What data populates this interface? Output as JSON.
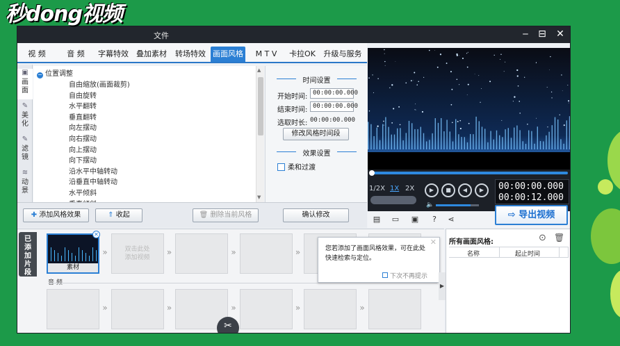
{
  "watermark": "秒dong视频",
  "window": {
    "title_suffix": "文件",
    "minimize": "‒",
    "maximize": "⊟",
    "close": "✕"
  },
  "tabs": [
    "视  频",
    "音  频",
    "字幕特效",
    "叠加素材",
    "转场特效",
    "画面风格",
    "M T V",
    "卡拉OK",
    "升级与服务"
  ],
  "active_tab": "画面风格",
  "side_tabs": [
    {
      "label": "画面",
      "icon": "square-icon"
    },
    {
      "label": "美化",
      "icon": "wand-icon"
    },
    {
      "label": "滤镜",
      "icon": "wand-icon"
    },
    {
      "label": "动景",
      "icon": "wave-icon"
    }
  ],
  "tree": {
    "header": "位置调整",
    "items": [
      "自由缩放(画面裁剪)",
      "自由旋转",
      "水平翻转",
      "垂直翻转",
      "向左摆动",
      "向右摆动",
      "向上摆动",
      "向下摆动",
      "沿水平中轴转动",
      "沿垂直中轴转动",
      "水平倾斜",
      "垂直倾斜"
    ]
  },
  "settings": {
    "time_header": "时间设置",
    "start_label": "开始时间:",
    "start_value": "00:00:00.000",
    "end_label": "结束时间:",
    "end_value": "00:00:00.000",
    "duration_label": "选取时长:",
    "duration_value": "00:00:00.000",
    "modify_range_button": "修改风格时间段",
    "effect_header": "效果设置",
    "fade_checkbox": "柔和过渡"
  },
  "actions": {
    "add_style": "添加风格效果",
    "collapse": "收起",
    "delete_style": "删除当前风格",
    "confirm": "确认修改"
  },
  "player": {
    "speeds": [
      "1/2X",
      "1X",
      "2X"
    ],
    "active_speed": "1X",
    "current_time": "00:00:00.000",
    "total_time": "00:00:12.000",
    "volume": 0.8
  },
  "export_button": "导出视频",
  "timeline": {
    "side_label": "已添加片段",
    "first_clip_label": "素材",
    "placeholder": "双击此处\n添加视频",
    "audio_label": "音  频",
    "video_slots": 6,
    "audio_slots": 6
  },
  "tooltip": {
    "text": "您若添加了画面风格效果，可在此处快速检索与定位。",
    "dont_show": "下次不再提示"
  },
  "right_pane": {
    "title": "所有画面风格:",
    "col_name": "名称",
    "col_start": "起止时间"
  },
  "colors": {
    "accent": "#2b7fd4",
    "background": "#1c9a49",
    "preview_bg": "#0a0c14"
  }
}
